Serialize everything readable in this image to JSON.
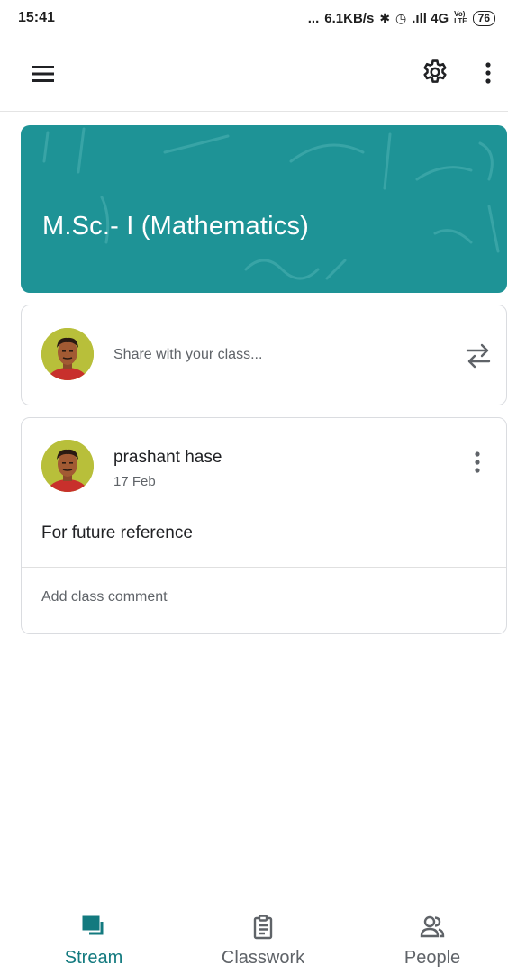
{
  "status_bar": {
    "time": "15:41",
    "dots": "...",
    "speed": "6.1KB/s",
    "bluetooth_glyph": "✱",
    "alarm_glyph": "◷",
    "signal": ".ıll 4G",
    "volte_top": "Vo)",
    "volte_bottom": "LTE",
    "battery": "76"
  },
  "app_bar": {
    "menu_icon": "hamburger-menu-icon",
    "settings_icon": "gear-icon",
    "more_icon": "more-vert-icon"
  },
  "class_banner": {
    "title": "M.Sc.- I (Mathematics)",
    "color": "#1e9396"
  },
  "share_card": {
    "placeholder": "Share with your class...",
    "repost_icon": "repost-icon"
  },
  "post": {
    "author": "prashant hase",
    "date": "17 Feb",
    "body": "For future reference",
    "comment_placeholder": "Add class comment"
  },
  "bottom_nav": {
    "active_color": "#137a7f",
    "items": [
      {
        "label": "Stream",
        "icon": "stream-icon",
        "active": true
      },
      {
        "label": "Classwork",
        "icon": "clipboard-icon",
        "active": false
      },
      {
        "label": "People",
        "icon": "people-icon",
        "active": false
      }
    ]
  }
}
